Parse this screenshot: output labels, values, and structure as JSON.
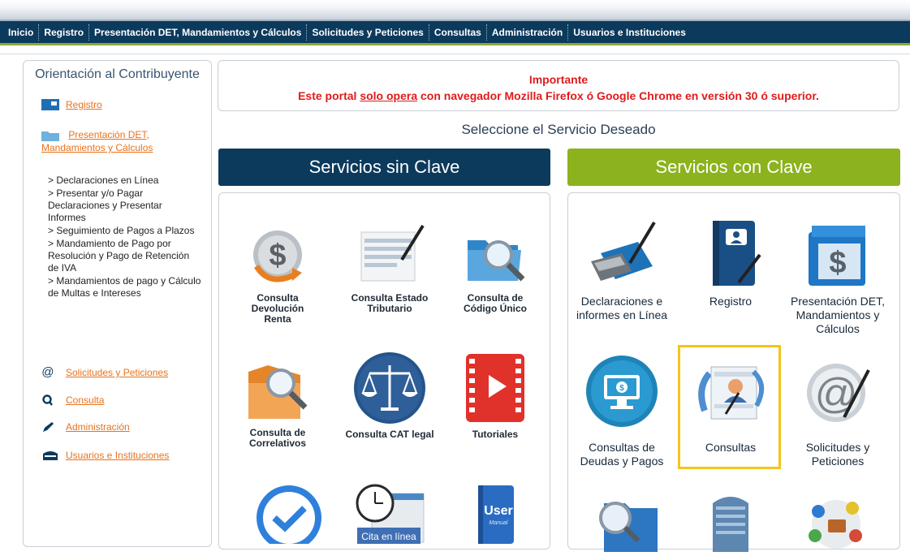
{
  "nav": {
    "items": [
      "Inicio",
      "Registro",
      "Presentación DET, Mandamientos y Cálculos",
      "Solicitudes y Peticiones",
      "Consultas",
      "Administración",
      "Usuarios e Instituciones"
    ]
  },
  "sidebar": {
    "title": "Orientación al Contribuyente",
    "registro": "Registro",
    "presentacion": "Presentación DET, Mandamientos y Cálculos",
    "sub_items": [
      "> Declaraciones en Línea",
      "> Presentar y/o Pagar Declaraciones y Presentar Informes",
      "> Seguimiento de Pagos a Plazos",
      "> Mandamiento de Pago por Resolución y Pago de Retención de IVA",
      "> Mandamientos de pago y Cálculo de Multas e Intereses"
    ],
    "solicitudes": "Solicitudes y Peticiones",
    "consulta": "Consulta",
    "administracion": "Administración",
    "usuarios": "Usuarios e Instituciones"
  },
  "notice": {
    "title": "Importante",
    "prefix": "Este portal ",
    "underlined": "solo opera",
    "suffix": " con navegador Mozilla Firefox ó Google Chrome en versión 30 ó superior."
  },
  "select_title": "Seleccione el Servicio Deseado",
  "bands": {
    "sin_clave": "Servicios sin Clave",
    "con_clave": "Servicios con Clave"
  },
  "sin_clave": {
    "items": [
      "Consulta Devolución Renta",
      "Consulta Estado Tributario",
      "Consulta de Código Único",
      "Consulta de Correlativos",
      "Consulta CAT legal",
      "Tutoriales"
    ],
    "cita_label": "Cita en línea",
    "user_label": "User",
    "manual_label": "Manual"
  },
  "con_clave": {
    "items": [
      "Declaraciones e informes en Línea",
      "Registro",
      "Presentación DET, Mandamientos y Cálculos",
      "Consultas de Deudas y Pagos",
      "Consultas",
      "Solicitudes y Peticiones"
    ]
  },
  "colors": {
    "navy": "#0c3a5c",
    "green": "#8cb21d",
    "notice_red": "#e01b1b",
    "link_orange": "#e8721c",
    "highlight": "#f5c518"
  }
}
